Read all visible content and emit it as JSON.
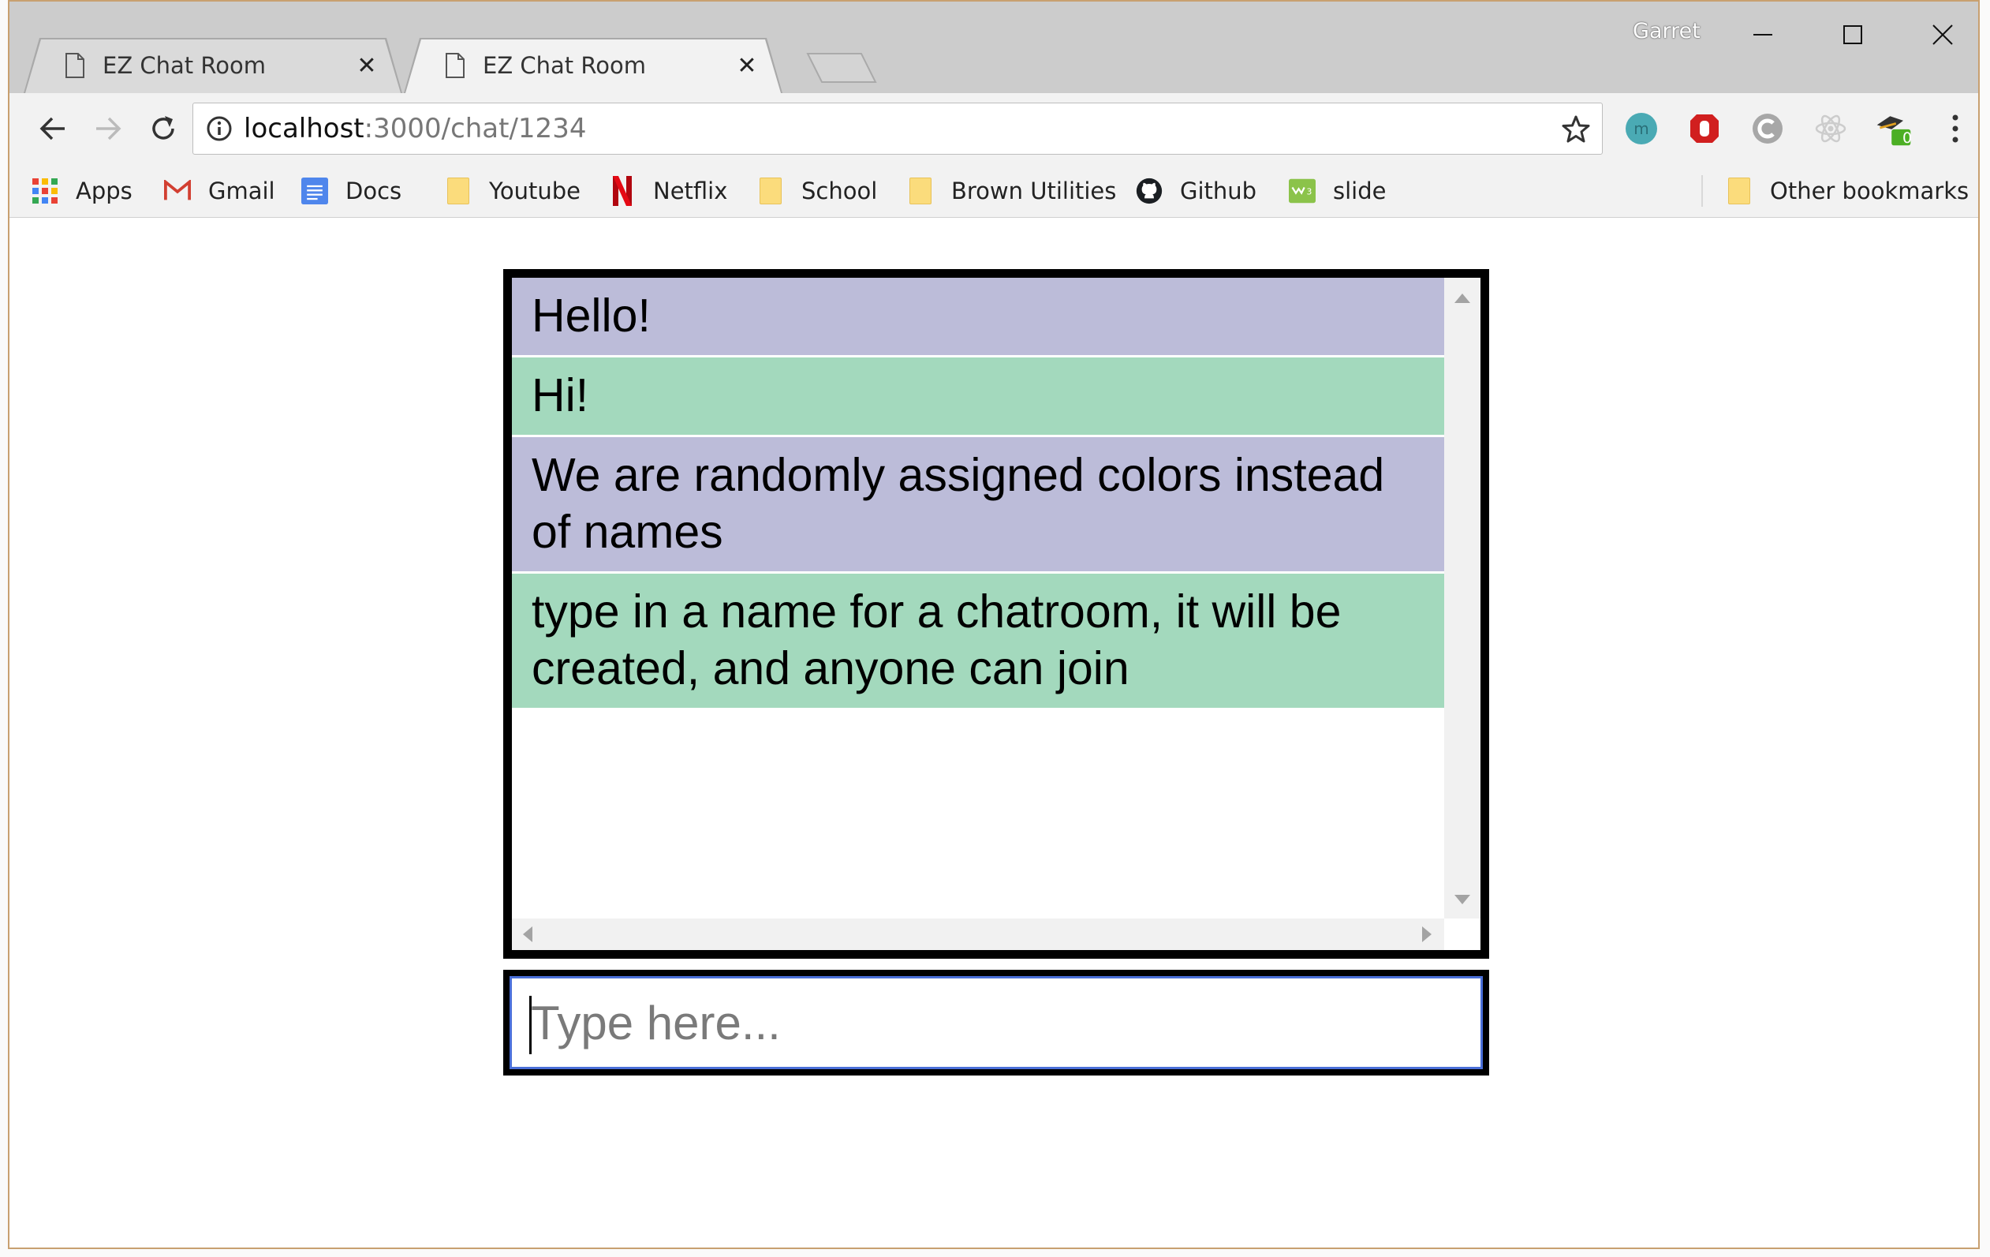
{
  "browser": {
    "profile_name": "Garret",
    "tabs": [
      {
        "title": "EZ Chat Room",
        "active": false
      },
      {
        "title": "EZ Chat Room",
        "active": true
      }
    ],
    "url_host": "localhost",
    "url_path": ":3000/chat/1234",
    "extension_badge": "0"
  },
  "bookmarks": {
    "items": [
      {
        "label": "Apps",
        "icon": "apps-grid-icon"
      },
      {
        "label": "Gmail",
        "icon": "gmail-icon"
      },
      {
        "label": "Docs",
        "icon": "docs-icon"
      },
      {
        "label": "Youtube",
        "icon": "folder-icon"
      },
      {
        "label": "Netflix",
        "icon": "netflix-icon"
      },
      {
        "label": "School",
        "icon": "folder-icon"
      },
      {
        "label": "Brown Utilities",
        "icon": "folder-icon"
      },
      {
        "label": "Github",
        "icon": "github-icon"
      },
      {
        "label": "slide",
        "icon": "slide-icon"
      }
    ],
    "other": "Other bookmarks"
  },
  "chat": {
    "colors": {
      "purple": "#bcbcd9",
      "green": "#a3d9bd",
      "accent": "#4a6fd8"
    },
    "messages": [
      {
        "text": "Hello!",
        "color": "#bcbcd9"
      },
      {
        "text": "Hi!",
        "color": "#a3d9bd"
      },
      {
        "text": "We are randomly assigned colors instead of names",
        "color": "#bcbcd9"
      },
      {
        "text": "type in a name for a chatroom, it will be created, and anyone can join",
        "color": "#a3d9bd"
      }
    ],
    "input_placeholder": "Type here..."
  }
}
